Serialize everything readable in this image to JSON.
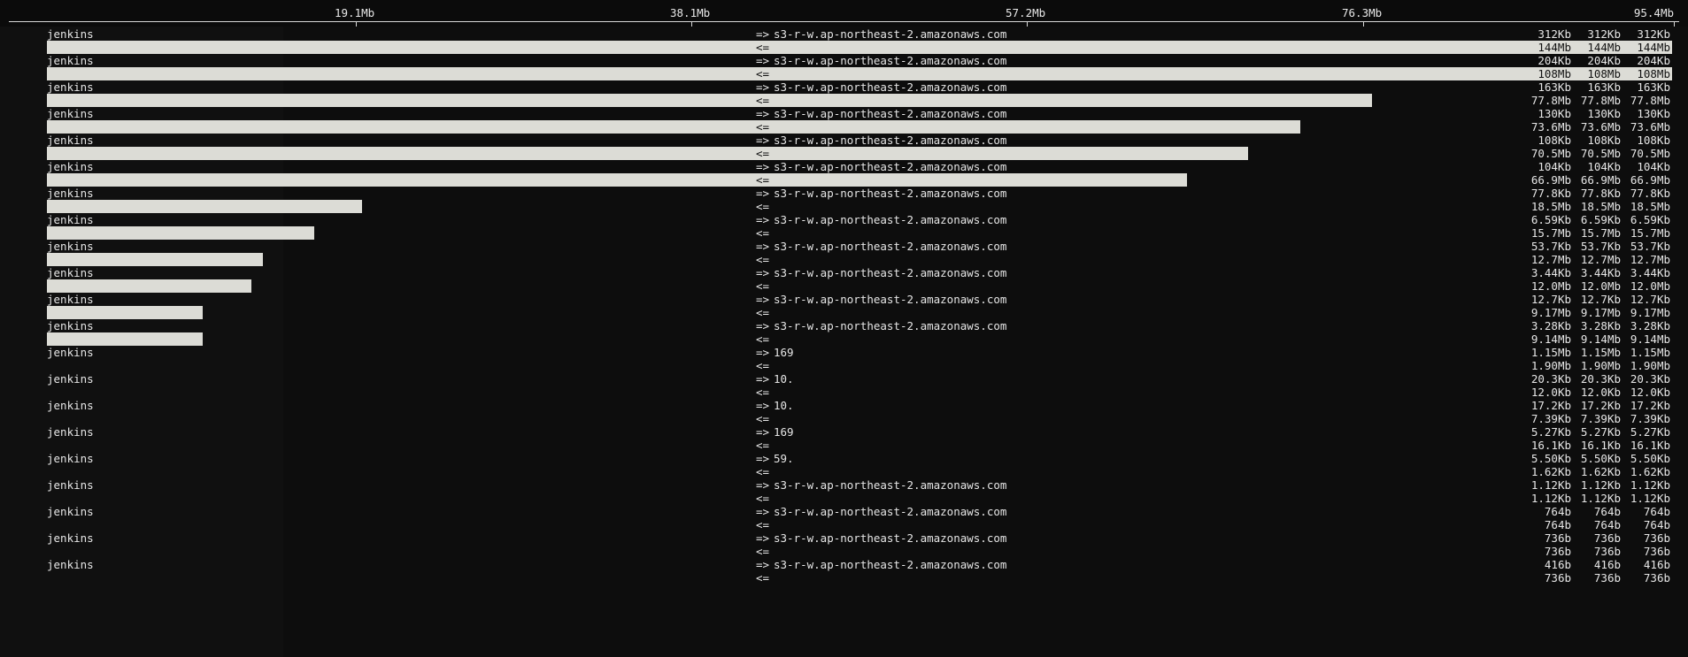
{
  "scale": {
    "max_mb": 95.4,
    "ticks": [
      "19.1Mb",
      "38.1Mb",
      "57.2Mb",
      "76.3Mb",
      "95.4Mb"
    ]
  },
  "arrows": {
    "sent": "=>",
    "recv": "<="
  },
  "connections": [
    {
      "host": "jenkins",
      "remote": "s3-r-w.ap-northeast-2.amazonaws.com",
      "sent": [
        "312Kb",
        "312Kb",
        "312Kb"
      ],
      "recv": [
        "144Mb",
        "144Mb",
        "144Mb"
      ],
      "bar_fraction": 1.0
    },
    {
      "host": "jenkins",
      "remote": "s3-r-w.ap-northeast-2.amazonaws.com",
      "sent": [
        "204Kb",
        "204Kb",
        "204Kb"
      ],
      "recv": [
        "108Mb",
        "108Mb",
        "108Mb"
      ],
      "bar_fraction": 1.0
    },
    {
      "host": "jenkins",
      "remote": "s3-r-w.ap-northeast-2.amazonaws.com",
      "sent": [
        "163Kb",
        "163Kb",
        "163Kb"
      ],
      "recv": [
        "77.8Mb",
        "77.8Mb",
        "77.8Mb"
      ],
      "bar_fraction": 0.8155
    },
    {
      "host": "jenkins",
      "remote": "s3-r-w.ap-northeast-2.amazonaws.com",
      "sent": [
        "130Kb",
        "130Kb",
        "130Kb"
      ],
      "recv": [
        "73.6Mb",
        "73.6Mb",
        "73.6Mb"
      ],
      "bar_fraction": 0.7715
    },
    {
      "host": "jenkins",
      "remote": "s3-r-w.ap-northeast-2.amazonaws.com",
      "sent": [
        "108Kb",
        "108Kb",
        "108Kb"
      ],
      "recv": [
        "70.5Mb",
        "70.5Mb",
        "70.5Mb"
      ],
      "bar_fraction": 0.739
    },
    {
      "host": "jenkins",
      "remote": "s3-r-w.ap-northeast-2.amazonaws.com",
      "sent": [
        "104Kb",
        "104Kb",
        "104Kb"
      ],
      "recv": [
        "66.9Mb",
        "66.9Mb",
        "66.9Mb"
      ],
      "bar_fraction": 0.7013
    },
    {
      "host": "jenkins",
      "remote": "s3-r-w.ap-northeast-2.amazonaws.com",
      "sent": [
        "77.8Kb",
        "77.8Kb",
        "77.8Kb"
      ],
      "recv": [
        "18.5Mb",
        "18.5Mb",
        "18.5Mb"
      ],
      "bar_fraction": 0.1939
    },
    {
      "host": "jenkins",
      "remote": "s3-r-w.ap-northeast-2.amazonaws.com",
      "sent": [
        "6.59Kb",
        "6.59Kb",
        "6.59Kb"
      ],
      "recv": [
        "15.7Mb",
        "15.7Mb",
        "15.7Mb"
      ],
      "bar_fraction": 0.1646
    },
    {
      "host": "jenkins",
      "remote": "s3-r-w.ap-northeast-2.amazonaws.com",
      "sent": [
        "53.7Kb",
        "53.7Kb",
        "53.7Kb"
      ],
      "recv": [
        "12.7Mb",
        "12.7Mb",
        "12.7Mb"
      ],
      "bar_fraction": 0.1331
    },
    {
      "host": "jenkins",
      "remote": "s3-r-w.ap-northeast-2.amazonaws.com",
      "sent": [
        "3.44Kb",
        "3.44Kb",
        "3.44Kb"
      ],
      "recv": [
        "12.0Mb",
        "12.0Mb",
        "12.0Mb"
      ],
      "bar_fraction": 0.1258
    },
    {
      "host": "jenkins",
      "remote": "s3-r-w.ap-northeast-2.amazonaws.com",
      "sent": [
        "12.7Kb",
        "12.7Kb",
        "12.7Kb"
      ],
      "recv": [
        "9.17Mb",
        "9.17Mb",
        "9.17Mb"
      ],
      "bar_fraction": 0.0961
    },
    {
      "host": "jenkins",
      "remote": "s3-r-w.ap-northeast-2.amazonaws.com",
      "sent": [
        "3.28Kb",
        "3.28Kb",
        "3.28Kb"
      ],
      "recv": [
        "9.14Mb",
        "9.14Mb",
        "9.14Mb"
      ],
      "bar_fraction": 0.0958
    },
    {
      "host": "jenkins",
      "remote": "169",
      "sent": [
        "1.15Mb",
        "1.15Mb",
        "1.15Mb"
      ],
      "recv": [
        "1.90Mb",
        "1.90Mb",
        "1.90Mb"
      ],
      "bar_fraction": 0
    },
    {
      "host": "jenkins",
      "remote": "10.",
      "sent": [
        "20.3Kb",
        "20.3Kb",
        "20.3Kb"
      ],
      "recv": [
        "12.0Kb",
        "12.0Kb",
        "12.0Kb"
      ],
      "bar_fraction": 0
    },
    {
      "host": "jenkins",
      "remote": "10.",
      "sent": [
        "17.2Kb",
        "17.2Kb",
        "17.2Kb"
      ],
      "recv": [
        "7.39Kb",
        "7.39Kb",
        "7.39Kb"
      ],
      "bar_fraction": 0
    },
    {
      "host": "jenkins",
      "remote": "169",
      "sent": [
        "5.27Kb",
        "5.27Kb",
        "5.27Kb"
      ],
      "recv": [
        "16.1Kb",
        "16.1Kb",
        "16.1Kb"
      ],
      "bar_fraction": 0
    },
    {
      "host": "jenkins",
      "remote": "59.",
      "sent": [
        "5.50Kb",
        "5.50Kb",
        "5.50Kb"
      ],
      "recv": [
        "1.62Kb",
        "1.62Kb",
        "1.62Kb"
      ],
      "bar_fraction": 0
    },
    {
      "host": "jenkins",
      "remote": "s3-r-w.ap-northeast-2.amazonaws.com",
      "sent": [
        "1.12Kb",
        "1.12Kb",
        "1.12Kb"
      ],
      "recv": [
        "1.12Kb",
        "1.12Kb",
        "1.12Kb"
      ],
      "bar_fraction": 0
    },
    {
      "host": "jenkins",
      "remote": "s3-r-w.ap-northeast-2.amazonaws.com",
      "sent": [
        "764b",
        "764b",
        "764b"
      ],
      "recv": [
        "764b",
        "764b",
        "764b"
      ],
      "bar_fraction": 0
    },
    {
      "host": "jenkins",
      "remote": "s3-r-w.ap-northeast-2.amazonaws.com",
      "sent": [
        "736b",
        "736b",
        "736b"
      ],
      "recv": [
        "736b",
        "736b",
        "736b"
      ],
      "bar_fraction": 0
    },
    {
      "host": "jenkins",
      "remote": "s3-r-w.ap-northeast-2.amazonaws.com",
      "sent": [
        "416b",
        "416b",
        "416b"
      ],
      "recv": [
        "736b",
        "736b",
        "736b"
      ],
      "bar_fraction": 0
    }
  ]
}
